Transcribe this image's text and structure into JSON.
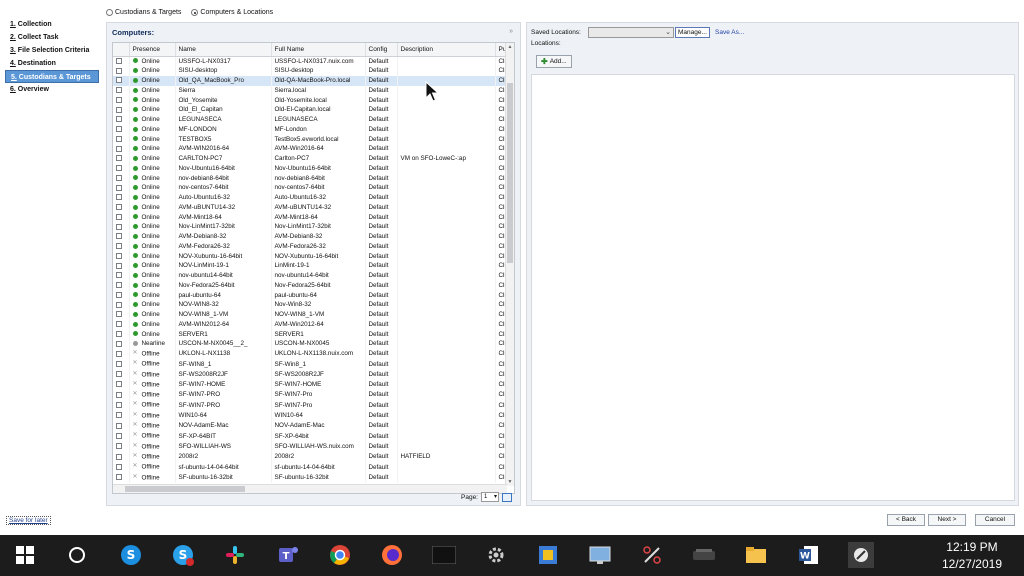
{
  "nav": {
    "items": [
      {
        "num": "1.",
        "label": "Collection"
      },
      {
        "num": "2.",
        "label": "Collect Task"
      },
      {
        "num": "3.",
        "label": "File Selection Criteria"
      },
      {
        "num": "4.",
        "label": "Destination"
      },
      {
        "num": "5.",
        "label": "Custodians & Targets"
      },
      {
        "num": "6.",
        "label": "Overview"
      }
    ],
    "active_index": 4,
    "save_later": "Save for later"
  },
  "mode": {
    "option1": "Custodians & Targets",
    "option2": "Computers & Locations",
    "selected": "Computers & Locations"
  },
  "computers": {
    "title": "Computers:",
    "columns": [
      "Presence",
      "Name",
      "Full Name",
      "Config",
      "Description",
      "Pur"
    ],
    "rows": [
      [
        "Online",
        "USSFO-L-NX0317",
        "USSFO-L-NX0317.nuix.com",
        "Default",
        "",
        "Clie"
      ],
      [
        "Online",
        "SISU-desktop",
        "SISU-desktop",
        "Default",
        "",
        "Clie"
      ],
      [
        "Online",
        "Old_QA_MacBook_Pro",
        "Old-QA-MacBook-Pro.local",
        "Default",
        "",
        "Clie"
      ],
      [
        "Online",
        "Sierra",
        "Sierra.local",
        "Default",
        "",
        "Clie"
      ],
      [
        "Online",
        "Old_Yosemite",
        "Old-Yosemite.local",
        "Default",
        "",
        "Clie"
      ],
      [
        "Online",
        "Old_El_Capitan",
        "Old-El-Capitan.local",
        "Default",
        "",
        "Clie"
      ],
      [
        "Online",
        "LEGUNASECA",
        "LEGUNASECA",
        "Default",
        "",
        "Clie"
      ],
      [
        "Online",
        "MF-LONDON",
        "MF-London",
        "Default",
        "",
        "Clie"
      ],
      [
        "Online",
        "TESTBOX5",
        "TestBox5.evworld.local",
        "Default",
        "",
        "Clie"
      ],
      [
        "Online",
        "AVM-WIN2016-64",
        "AVM-Win2016-64",
        "Default",
        "",
        "Clie"
      ],
      [
        "Online",
        "CARLTON-PC7",
        "Carlton-PC7",
        "Default",
        "VM on SFO-LoweC-:ap",
        "Clie"
      ],
      [
        "Online",
        "Nov-Ubuntu16-64bit",
        "Nov-Ubuntu16-64bit",
        "Default",
        "",
        "Clie"
      ],
      [
        "Online",
        "nov-debian8-64bit",
        "nov-debian8-64bit",
        "Default",
        "",
        "Clie"
      ],
      [
        "Online",
        "nov-centos7-64bit",
        "nov-centos7-64bit",
        "Default",
        "",
        "Clie"
      ],
      [
        "Online",
        "Auto-Ubuntu16-32",
        "Auto-Ubuntu16-32",
        "Default",
        "",
        "Clie"
      ],
      [
        "Online",
        "AVM-uBUNTU14-32",
        "AVM-uBUNTU14-32",
        "Default",
        "",
        "Clie"
      ],
      [
        "Online",
        "AVM-Mint18-64",
        "AVM-Mint18-64",
        "Default",
        "",
        "Clie"
      ],
      [
        "Online",
        "Nov-LinMint17-32bit",
        "Nov-LinMint17-32bit",
        "Default",
        "",
        "Clie"
      ],
      [
        "Online",
        "AVM-Debian8-32",
        "AVM-Debian8-32",
        "Default",
        "",
        "Clie"
      ],
      [
        "Online",
        "AVM-Fedora26-32",
        "AVM-Fedora26-32",
        "Default",
        "",
        "Clie"
      ],
      [
        "Online",
        "NOV-Xubuntu-16-64bit",
        "NOV-Xubuntu-16-64bit",
        "Default",
        "",
        "Clie"
      ],
      [
        "Online",
        "NOV-LinMint-19-1",
        "LinMint-19-1",
        "Default",
        "",
        "Clie"
      ],
      [
        "Online",
        "nov-ubuntu14-64bit",
        "nov-ubuntu14-64bit",
        "Default",
        "",
        "Clie"
      ],
      [
        "Online",
        "Nov-Fedora25-64bit",
        "Nov-Fedora25-64bit",
        "Default",
        "",
        "Clie"
      ],
      [
        "Online",
        "paul-ubuntu-64",
        "paul-ubuntu-64",
        "Default",
        "",
        "Clie"
      ],
      [
        "Online",
        "NOV-WIN8-32",
        "Nov-Win8-32",
        "Default",
        "",
        "Clie"
      ],
      [
        "Online",
        "NOV-WIN8_1-VM",
        "NOV-WIN8_1-VM",
        "Default",
        "",
        "Clie"
      ],
      [
        "Online",
        "AVM-WIN2012-64",
        "AVM-Win2012-64",
        "Default",
        "",
        "Clie"
      ],
      [
        "Online",
        "SERVER1",
        "SERVER1",
        "Default",
        "",
        "Clie"
      ],
      [
        "Nearline",
        "USCON-M-NX0045__2_",
        "USCON-M-NX0045",
        "Default",
        "",
        "Clie"
      ],
      [
        "Offline",
        "UKLON-L-NX1138",
        "UKLON-L-NX1138.nuix.com",
        "Default",
        "",
        "Clie"
      ],
      [
        "Offline",
        "SF-WIN8_1",
        "SF-Win8_1",
        "Default",
        "",
        "Clie"
      ],
      [
        "Offline",
        "SF-WS2008R2JF",
        "SF-WS2008R2JF",
        "Default",
        "",
        "Clie"
      ],
      [
        "Offline",
        "SF-WIN7-HOME",
        "SF-WIN7-HOME",
        "Default",
        "",
        "Clie"
      ],
      [
        "Offline",
        "SF-WIN7-PRO",
        "SF-WIN7-Pro",
        "Default",
        "",
        "Clie"
      ],
      [
        "Offline",
        "SF-WIN7-PRO",
        "SF-WIN7-Pro",
        "Default",
        "",
        "Clie"
      ],
      [
        "Offline",
        "WIN10-64",
        "WIN10-64",
        "Default",
        "",
        "Clie"
      ],
      [
        "Offline",
        "NOV-AdamE-Mac",
        "NOV-AdamE-Mac",
        "Default",
        "",
        "Clie"
      ],
      [
        "Offline",
        "SF-XP-64BIT",
        "SF-XP-64bit",
        "Default",
        "",
        "Clie"
      ],
      [
        "Offline",
        "SFO-WILLIAH-WS",
        "SFO-WILLIAH-WS.nuix.com",
        "Default",
        "",
        "Clie"
      ],
      [
        "Offline",
        "2008r2",
        "2008r2",
        "Default",
        "HATFIELD",
        "Clie"
      ],
      [
        "Offline",
        "sf-ubuntu-14-04-64bit",
        "sf-ubuntu-14-04-64bit",
        "Default",
        "",
        "Clie"
      ],
      [
        "Offline",
        "SF-ubuntu-16-32bit",
        "SF-ubuntu-16-32bit",
        "Default",
        "",
        "Clie"
      ]
    ],
    "selected_row": 2,
    "page_label": "Page:",
    "page_value": "1"
  },
  "locations": {
    "saved_label": "Saved Locations:",
    "manage_label": "Manage...",
    "saveas_label": "Save As...",
    "locations_label": "Locations:",
    "add_label": "Add..."
  },
  "footer": {
    "back_label": "< Back",
    "next_label": "Next >",
    "cancel_label": "Cancel"
  },
  "taskbar": {
    "time": "12:19 PM",
    "date": "12/27/2019"
  },
  "colors": {
    "online": "#2e9a2e",
    "nav_active": "#5b97d6",
    "link": "#2344a8"
  }
}
